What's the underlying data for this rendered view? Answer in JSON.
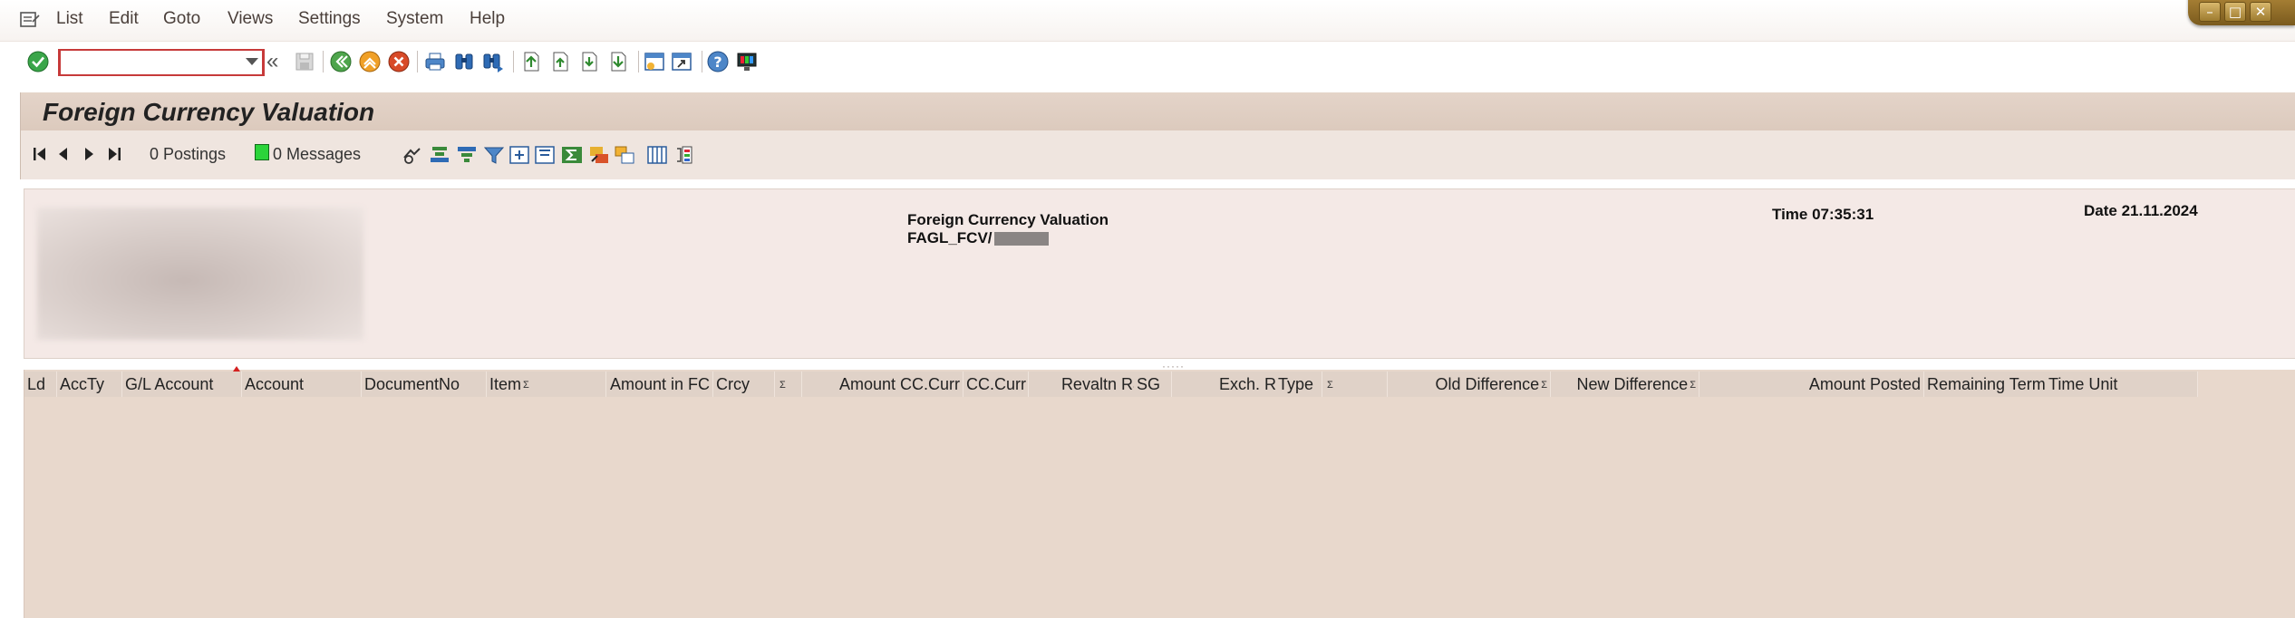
{
  "menubar": {
    "items": [
      "List",
      "Edit",
      "Goto",
      "Views",
      "Settings",
      "System",
      "Help"
    ]
  },
  "toolbar": {
    "command_value": "",
    "icons": [
      "enter-icon",
      "command-field",
      "save-icon",
      "back-icon",
      "exit-icon",
      "cancel-icon",
      "print-icon",
      "find-icon",
      "find-next-icon",
      "first-page-icon",
      "previous-page-icon",
      "next-page-icon",
      "last-page-icon",
      "create-session-icon",
      "shortcut-icon",
      "help-icon",
      "customize-layout-icon"
    ]
  },
  "page": {
    "title": "Foreign Currency Valuation"
  },
  "app_toolbar": {
    "postings": "0 Postings",
    "messages": "0 Messages",
    "message_status_color": "#2bd43a"
  },
  "report_header": {
    "title": "Foreign Currency Valuation",
    "program": "FAGL_FCV/",
    "time": "Time 07:35:31",
    "date": "Date 21.11.2024"
  },
  "grid": {
    "columns": [
      {
        "label": "Ld",
        "sigma": false
      },
      {
        "label": "AccTy",
        "sigma": false
      },
      {
        "label": "G/L Account",
        "sigma": false
      },
      {
        "label": "Account",
        "sigma": false
      },
      {
        "label": "DocumentNo",
        "sigma": false
      },
      {
        "label": "Item",
        "sigma": true
      },
      {
        "label": "Amount in FC",
        "sigma": false
      },
      {
        "label": "Crcy",
        "sigma": false
      },
      {
        "label": "",
        "sigma": true
      },
      {
        "label": "Amount CC.Curr",
        "sigma": false
      },
      {
        "label": "CC.Curr",
        "sigma": false
      },
      {
        "label": "Revaltn Rate",
        "sigma": false
      },
      {
        "label": "SG",
        "sigma": false
      },
      {
        "label": "Exch. Rate",
        "sigma": false
      },
      {
        "label": "Type",
        "sigma": false
      },
      {
        "label": "",
        "sigma": true
      },
      {
        "label": "Old Difference",
        "sigma": true
      },
      {
        "label": "New Difference",
        "sigma": true
      },
      {
        "label": "Amount Posted",
        "sigma": false
      },
      {
        "label": "Remaining Term",
        "sigma": false
      },
      {
        "label": "Time Unit",
        "sigma": false
      }
    ]
  },
  "colors": {
    "title_bg": "#dccabd",
    "grid_bg": "#e8d8cc",
    "header_bg": "#f4e9e6"
  }
}
